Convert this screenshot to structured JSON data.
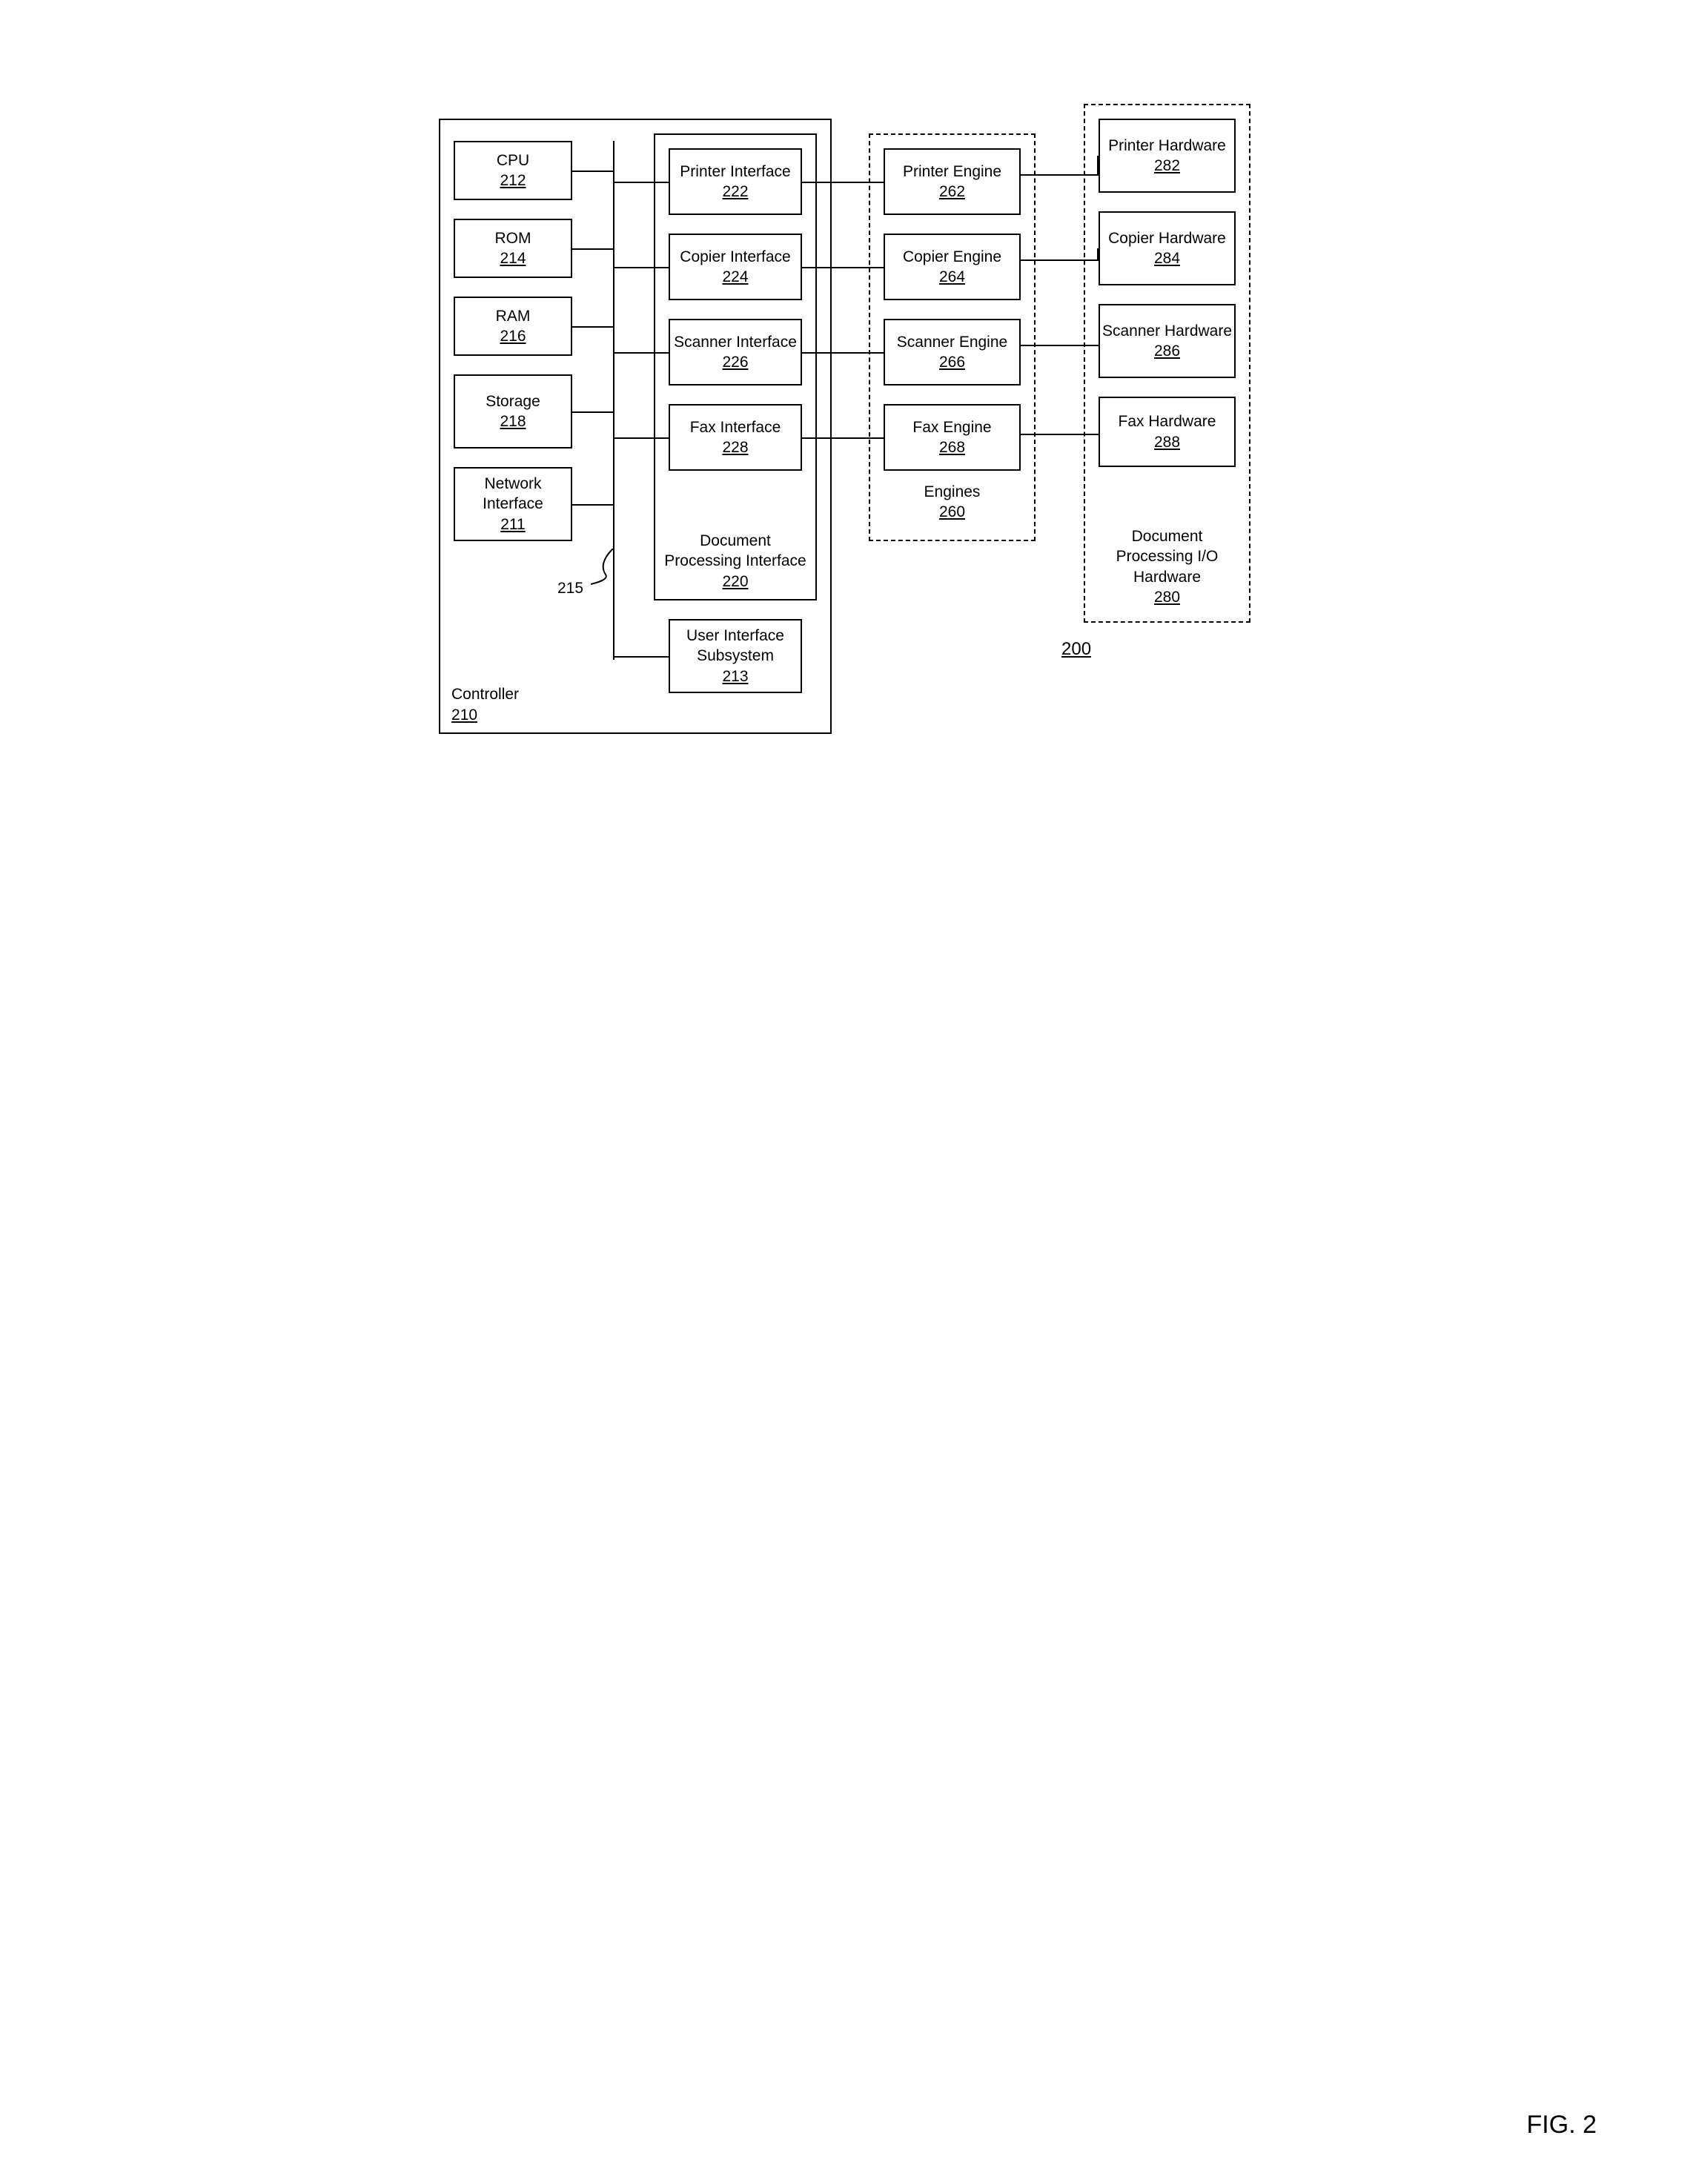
{
  "figure_label": "FIG. 2",
  "system_ref": "200",
  "bus_ref": "215",
  "controller": {
    "label": "Controller",
    "ref": "210"
  },
  "left_col": [
    {
      "label": "CPU",
      "ref": "212"
    },
    {
      "label": "ROM",
      "ref": "214"
    },
    {
      "label": "RAM",
      "ref": "216"
    },
    {
      "label": "Storage",
      "ref": "218"
    },
    {
      "label": "Network Interface",
      "ref": "211"
    }
  ],
  "interfaces_group": {
    "label": "Document Processing Interface",
    "ref": "220"
  },
  "interfaces": [
    {
      "label": "Printer Interface",
      "ref": "222"
    },
    {
      "label": "Copier Interface",
      "ref": "224"
    },
    {
      "label": "Scanner Interface",
      "ref": "226"
    },
    {
      "label": "Fax Interface",
      "ref": "228"
    }
  ],
  "ui_subsystem": {
    "label": "User Interface Subsystem",
    "ref": "213"
  },
  "engines_group": {
    "label": "Engines",
    "ref": "260"
  },
  "engines": [
    {
      "label": "Printer Engine",
      "ref": "262"
    },
    {
      "label": "Copier Engine",
      "ref": "264"
    },
    {
      "label": "Scanner Engine",
      "ref": "266"
    },
    {
      "label": "Fax Engine",
      "ref": "268"
    }
  ],
  "hardware_group": {
    "label": "Document Processing I/O Hardware",
    "ref": "280"
  },
  "hardware": [
    {
      "label": "Printer Hardware",
      "ref": "282"
    },
    {
      "label": "Copier Hardware",
      "ref": "284"
    },
    {
      "label": "Scanner Hardware",
      "ref": "286"
    },
    {
      "label": "Fax Hardware",
      "ref": "288"
    }
  ]
}
